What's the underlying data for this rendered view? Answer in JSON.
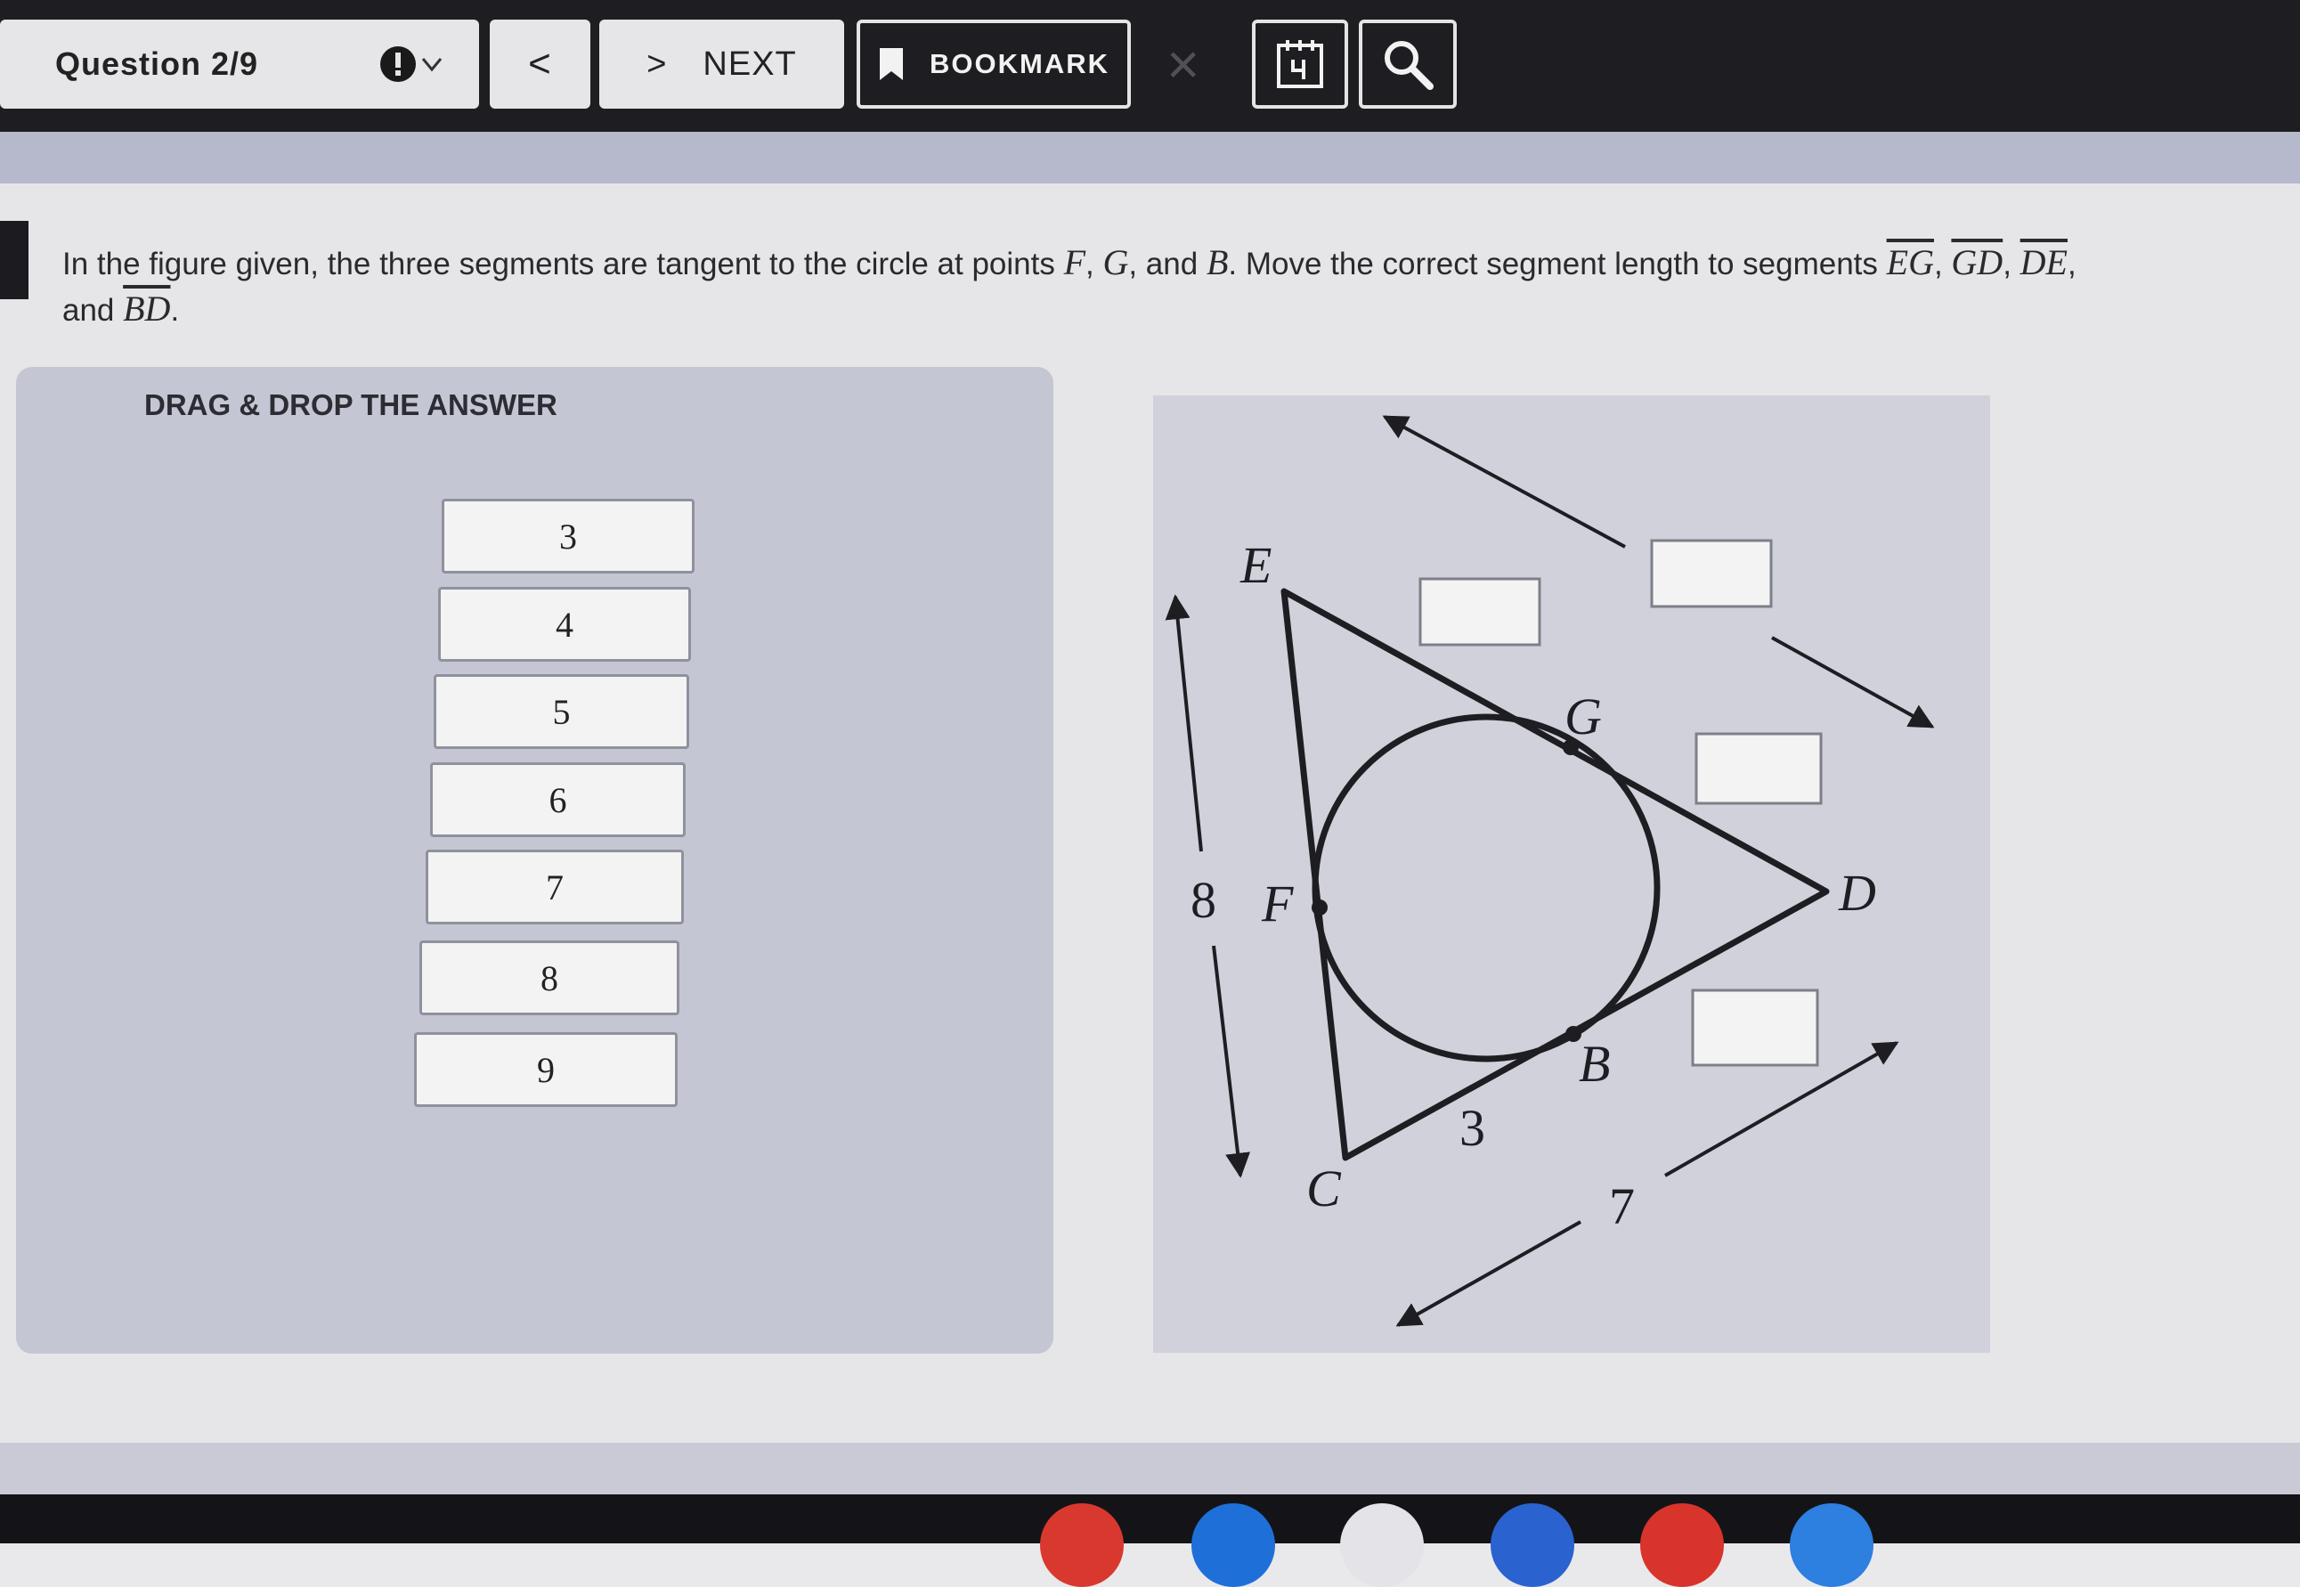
{
  "toolbar": {
    "question_label": "Question 2/9",
    "prev_label": "<",
    "next_arrow": ">",
    "next_label": "NEXT",
    "bookmark_label": "BOOKMARK",
    "close_label": "×"
  },
  "question": {
    "text_1": "In the figure given, the three segments are tangent to the circle at points ",
    "F": "F",
    "sep_1": ", ",
    "G": "G",
    "sep_2": ", and ",
    "B": "B",
    "text_2": ".  Move the correct segment length to segments ",
    "EG": "EG",
    "sep_3": ", ",
    "GD": "GD",
    "sep_4": ", ",
    "DE": "DE",
    "sep_5": ",",
    "text_3": " and ",
    "BD": "BD",
    "end": "."
  },
  "answer_panel": {
    "title": "DRAG & DROP THE ANSWER",
    "tiles": [
      "3",
      "4",
      "5",
      "6",
      "7",
      "8",
      "9"
    ]
  },
  "figure": {
    "labels": {
      "E": "E",
      "G": "G",
      "D": "D",
      "F": "F",
      "B": "B",
      "C": "C",
      "len_CE": "8",
      "len_CB": "3",
      "len_CD": "7"
    }
  },
  "colors": {
    "toolbar_bg": "#1e1e22",
    "panel_bg": "#c4c6d3",
    "figure_bg": "#d0d1da",
    "line": "#1d1d22"
  }
}
